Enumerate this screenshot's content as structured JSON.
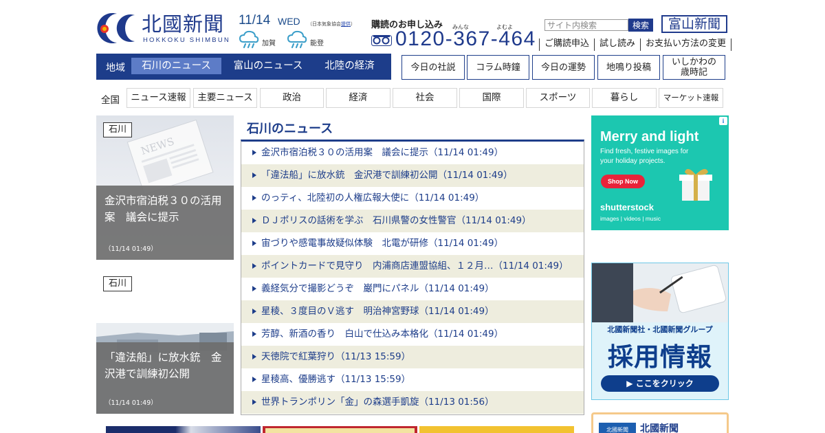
{
  "header": {
    "logo_text": "北國新聞",
    "logo_sub": "HOKKOKU SHIMBUN",
    "date": "11/14",
    "weekday": "WED",
    "weather_credit_prefix": "（日本気象協会",
    "weather_credit_link": "提供",
    "weather_credit_suffix": "）",
    "weather": [
      {
        "area": "加賀",
        "icon": "rain-cloud-icon"
      },
      {
        "area": "能登",
        "icon": "rain-cloud-icon"
      }
    ],
    "subscribe_title": "購読のお申し込み",
    "ruby_1": "みんな",
    "ruby_2": "よむよ",
    "phone": "0120-367-464",
    "search_placeholder": "サイト内検索",
    "search_button": "検索",
    "toyama_logo": "富山新聞",
    "top_links": [
      "ご購読申込",
      "試し読み",
      "お支払い方法の変更"
    ]
  },
  "region_nav": {
    "label": "地域",
    "tabs": [
      {
        "label": "石川のニュース",
        "active": true
      },
      {
        "label": "富山のニュース",
        "active": false
      },
      {
        "label": "北陸の経済",
        "active": false
      }
    ]
  },
  "link_buttons": [
    "今日の社説",
    "コラム時鐘",
    "今日の運勢",
    "地鳴り投稿",
    "いしかわの\n歳時記"
  ],
  "category_nav": {
    "all": "全国",
    "tabs": [
      "ニュース速報",
      "主要ニュース",
      "政治",
      "経済",
      "社会",
      "国際",
      "スポーツ",
      "暮らし",
      "マーケット速報"
    ]
  },
  "features": [
    {
      "region": "石川",
      "title": "金沢市宿泊税３０の活用案　議会に提示",
      "time": "（11/14 01:49）"
    },
    {
      "region": "石川",
      "title": "「違法船」に放水銃　金沢港で訓練初公開",
      "time": "（11/14 01:49）"
    }
  ],
  "section_title": "石川のニュース",
  "news": [
    "金沢市宿泊税３０の活用案　議会に提示（11/14 01:49）",
    "「違法船」に放水銃　金沢港で訓練初公開（11/14 01:49）",
    "のっティ、北陸初の人権広報大使に（11/14 01:49）",
    "ＤＪポリスの話術を学ぶ　石川県警の女性警官（11/14 01:49）",
    "宙づりや感電事故疑似体験　北電が研修（11/14 01:49）",
    "ポイントカードで見守り　内浦商店連盟協組、１２月…（11/14 01:49）",
    "義経気分で撮影どうぞ　巌門にパネル（11/14 01:49）",
    "星稜、３度目のＶ逃す　明治神宮野球（11/14 01:49）",
    "芳醇、新酒の香り　白山で仕込み本格化（11/14 01:49）",
    "天徳院で紅葉狩り（11/13 15:59）",
    "星稜高、優勝逃す（11/13 15:59）",
    "世界トランポリン「金」の森選手凱旋（11/13 01:56）"
  ],
  "ads": {
    "shutterstock": {
      "title": "Merry and light",
      "sub": "Find fresh, festive images for your holiday projects.",
      "button": "Shop Now",
      "brand": "shutterstock",
      "brand_sub": "images  |  videos  |  music",
      "info": "i"
    },
    "recruit": {
      "org": "北國新聞社・北國新聞グループ",
      "title": "採用情報",
      "button": "▶ ここをクリック"
    },
    "hokkoku_banner": {
      "text": "北國新聞",
      "logo": "北國新聞"
    }
  },
  "colors": {
    "brand_navy": "#1d3d8a",
    "active_tab": "#5d7cc7",
    "alt_row": "#eeedde",
    "ad_teal": "#1cc7b0"
  }
}
